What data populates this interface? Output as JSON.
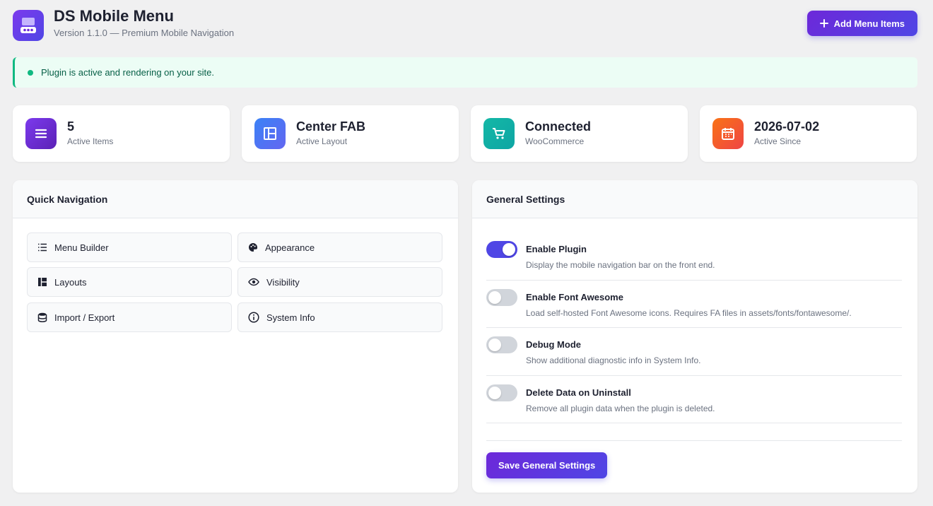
{
  "header": {
    "title": "DS Mobile Menu",
    "subtitle": "Version 1.1.0 — Premium Mobile Navigation",
    "add_button_label": "Add Menu Items"
  },
  "notice": {
    "text": "Plugin is active and rendering on your site."
  },
  "stats": [
    {
      "value": "5",
      "label": "Active Items",
      "icon": "list-icon",
      "color": "#6d28d9"
    },
    {
      "value": "Center FAB",
      "label": "Active Layout",
      "icon": "layout-icon",
      "color": "#4f6ef0"
    },
    {
      "value": "Connected",
      "label": "WooCommerce",
      "icon": "cart-icon",
      "color": "#14b8a6"
    },
    {
      "value": "2026-07-02",
      "label": "Active Since",
      "icon": "calendar-icon",
      "color": "#f97316"
    }
  ],
  "quick_nav": {
    "title": "Quick Navigation",
    "items": [
      {
        "label": "Menu Builder",
        "icon": "list-icon"
      },
      {
        "label": "Appearance",
        "icon": "palette-icon"
      },
      {
        "label": "Layouts",
        "icon": "layout-icon"
      },
      {
        "label": "Visibility",
        "icon": "eye-icon"
      },
      {
        "label": "Import / Export",
        "icon": "database-icon"
      },
      {
        "label": "System Info",
        "icon": "info-icon"
      }
    ]
  },
  "general_settings": {
    "title": "General Settings",
    "settings": [
      {
        "title": "Enable Plugin",
        "desc": "Display the mobile navigation bar on the front end.",
        "enabled": true
      },
      {
        "title": "Enable Font Awesome",
        "desc": "Load self-hosted Font Awesome icons. Requires FA files in assets/fonts/fontawesome/.",
        "enabled": false
      },
      {
        "title": "Debug Mode",
        "desc": "Show additional diagnostic info in System Info.",
        "enabled": false
      },
      {
        "title": "Delete Data on Uninstall",
        "desc": "Remove all plugin data when the plugin is deleted.",
        "enabled": false
      }
    ],
    "save_label": "Save General Settings"
  },
  "colors": {
    "accent": "#4f46e5",
    "success": "#10b981",
    "background": "#f0f0f1"
  }
}
